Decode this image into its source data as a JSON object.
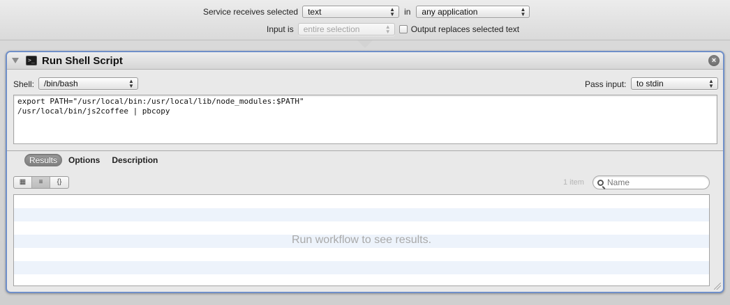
{
  "service": {
    "receives_label": "Service receives selected",
    "receives_value": "text",
    "in_label": "in",
    "app_value": "any application",
    "input_is_label": "Input is",
    "input_value": "entire selection",
    "output_replaces_label": "Output replaces selected text",
    "output_replaces_checked": false
  },
  "action": {
    "title": "Run Shell Script",
    "icon": "terminal-icon",
    "close_icon": "close-icon",
    "shell_label": "Shell:",
    "shell_value": "/bin/bash",
    "pass_input_label": "Pass input:",
    "pass_input_value": "to stdin",
    "script_lines": [
      "export PATH=\"/usr/local/bin:/usr/local/lib/node_modules:$PATH\"",
      "/usr/local/bin/js2coffee | pbcopy"
    ]
  },
  "tabs": [
    {
      "label": "Results",
      "active": true
    },
    {
      "label": "Options",
      "active": false
    },
    {
      "label": "Description",
      "active": false
    }
  ],
  "results": {
    "view_modes": [
      "icon-view-icon",
      "list-view-icon",
      "code-view-icon"
    ],
    "view_mode_glyphs": [
      "▦",
      "≡",
      "{}"
    ],
    "selected_view": "list-view-icon",
    "count_label": "1 item",
    "search_placeholder": "Name",
    "empty_message": "Run workflow to see results."
  },
  "colors": {
    "panel_border": "#6f8fc9",
    "stripe": "#edf3fb"
  }
}
